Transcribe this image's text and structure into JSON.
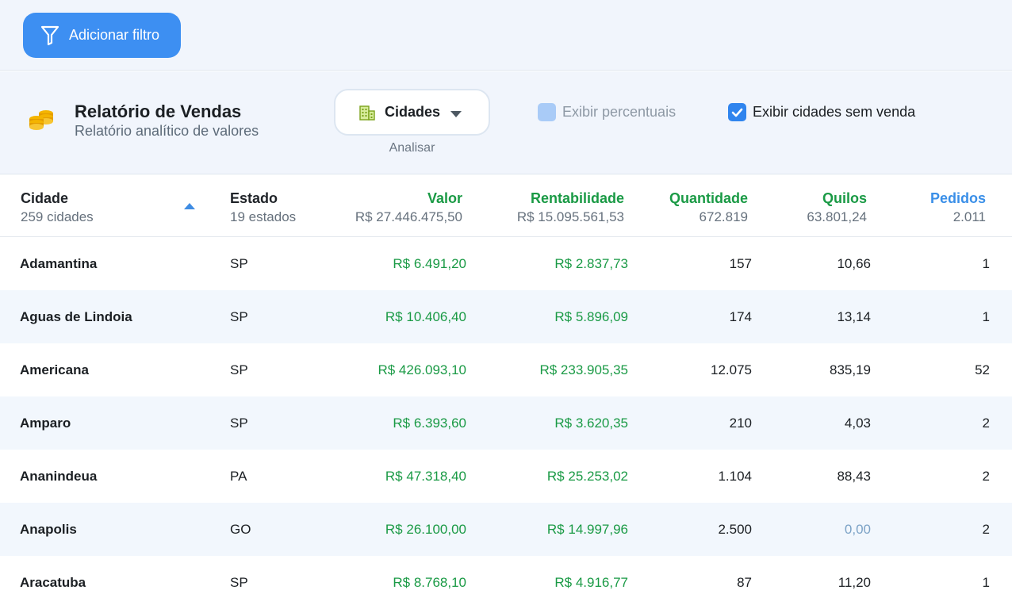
{
  "toolbar": {
    "filter_label": "Adicionar filtro"
  },
  "report": {
    "title": "Relatório de Vendas",
    "subtitle": "Relatório analítico de valores",
    "icon": "coins-icon",
    "selector_value": "Cidades",
    "selector_caption": "Analisar",
    "show_percent_label": "Exibir percentuais",
    "show_percent_checked": false,
    "show_no_sales_label": "Exibir cidades sem venda",
    "show_no_sales_checked": true
  },
  "colors": {
    "accent": "#3d8ff2",
    "green": "#1a9a45",
    "blue": "#3a8fe8"
  },
  "columns": {
    "cidade": {
      "label": "Cidade",
      "sub": "259 cidades"
    },
    "estado": {
      "label": "Estado",
      "sub": "19 estados"
    },
    "valor": {
      "label": "Valor",
      "sub": "R$ 27.446.475,50"
    },
    "rentabilidade": {
      "label": "Rentabilidade",
      "sub": "R$ 15.095.561,53"
    },
    "quantidade": {
      "label": "Quantidade",
      "sub": "672.819"
    },
    "quilos": {
      "label": "Quilos",
      "sub": "63.801,24"
    },
    "pedidos": {
      "label": "Pedidos",
      "sub": "2.011"
    }
  },
  "rows": [
    {
      "cidade": "Adamantina",
      "estado": "SP",
      "valor": "R$ 6.491,20",
      "rentabilidade": "R$ 2.837,73",
      "quantidade": "157",
      "quilos": "10,66",
      "pedidos": "1"
    },
    {
      "cidade": "Aguas de Lindoia",
      "estado": "SP",
      "valor": "R$ 10.406,40",
      "rentabilidade": "R$ 5.896,09",
      "quantidade": "174",
      "quilos": "13,14",
      "pedidos": "1"
    },
    {
      "cidade": "Americana",
      "estado": "SP",
      "valor": "R$ 426.093,10",
      "rentabilidade": "R$ 233.905,35",
      "quantidade": "12.075",
      "quilos": "835,19",
      "pedidos": "52"
    },
    {
      "cidade": "Amparo",
      "estado": "SP",
      "valor": "R$ 6.393,60",
      "rentabilidade": "R$ 3.620,35",
      "quantidade": "210",
      "quilos": "4,03",
      "pedidos": "2"
    },
    {
      "cidade": "Ananindeua",
      "estado": "PA",
      "valor": "R$ 47.318,40",
      "rentabilidade": "R$ 25.253,02",
      "quantidade": "1.104",
      "quilos": "88,43",
      "pedidos": "2"
    },
    {
      "cidade": "Anapolis",
      "estado": "GO",
      "valor": "R$ 26.100,00",
      "rentabilidade": "R$ 14.997,96",
      "quantidade": "2.500",
      "quilos": "0,00",
      "pedidos": "2"
    },
    {
      "cidade": "Aracatuba",
      "estado": "SP",
      "valor": "R$ 8.768,10",
      "rentabilidade": "R$ 4.916,77",
      "quantidade": "87",
      "quilos": "11,20",
      "pedidos": "1"
    }
  ]
}
